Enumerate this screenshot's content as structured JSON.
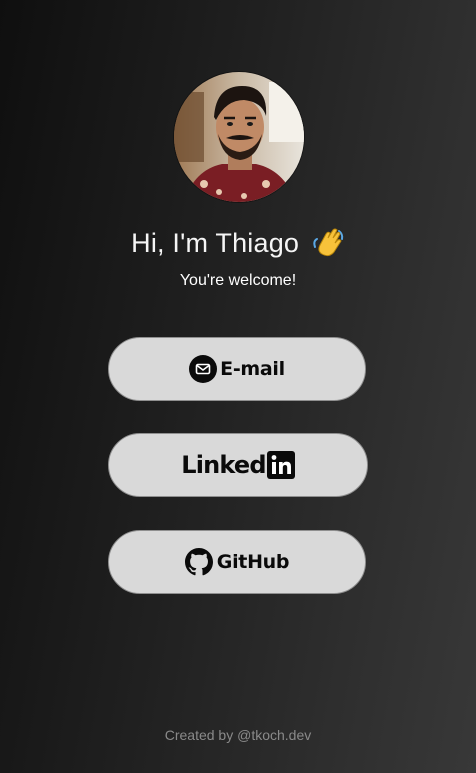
{
  "profile": {
    "greeting": "Hi, I'm Thiago",
    "greeting_emoji": "waving-hand-icon",
    "subtitle": "You're welcome!"
  },
  "links": {
    "email": {
      "label": "E-mail",
      "icon": "mail-icon"
    },
    "linkedin": {
      "label": "Linked",
      "icon": "linkedin-in-icon"
    },
    "github": {
      "label": "GitHub",
      "icon": "github-icon"
    }
  },
  "footer": {
    "credit": "Created by @tkoch.dev"
  },
  "colors": {
    "button_bg": "#d9d9d9",
    "text_light": "#f5f5f5",
    "footer_text": "#8a8a8a"
  }
}
